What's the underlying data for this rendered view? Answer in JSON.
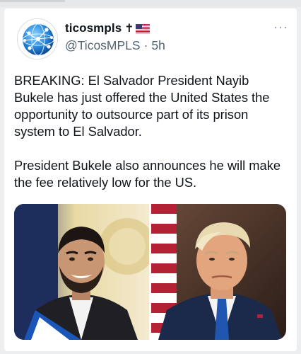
{
  "post": {
    "display_name": "ticosmpls",
    "cross_glyph": "✝",
    "flag_icon": "us-flag-icon",
    "handle": "@TicosMPLS",
    "separator": "·",
    "time": "5h",
    "more_label": "···",
    "text_paragraph_1": "BREAKING: El Salvador President Nayib Bukele has just offered the United States the opportunity to outsource part of its prison system to El Salvador.",
    "text_paragraph_2": "President Bukele also announces he will make the fee relatively low for the US."
  },
  "media": {
    "photos": [
      {
        "name": "photo-bukele"
      },
      {
        "name": "photo-trump"
      }
    ]
  },
  "colors": {
    "text": "#0f1419",
    "secondary": "#536471",
    "background": "#eceeef",
    "card": "#ffffff"
  }
}
